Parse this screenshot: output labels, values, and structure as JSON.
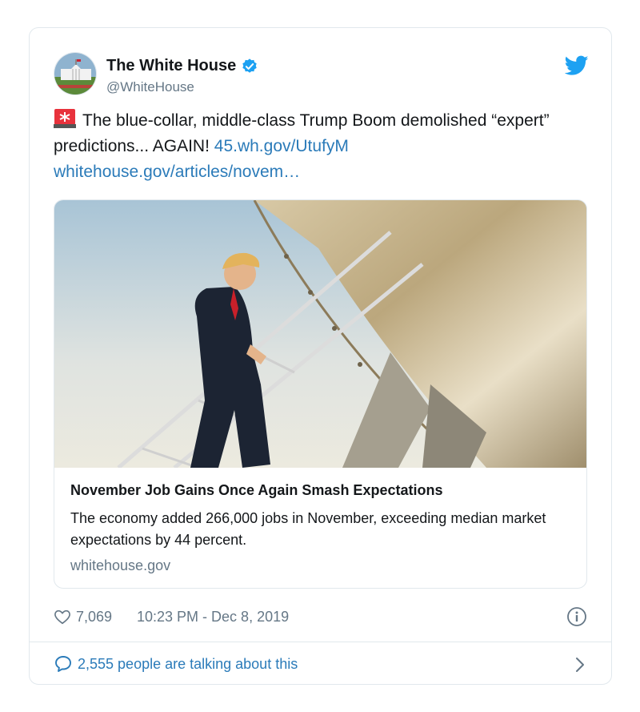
{
  "author": {
    "name": "The White House",
    "handle": "@WhiteHouse"
  },
  "tweet": {
    "text_prefix": "The blue-collar, middle-class Trump Boom demolished “expert” predictions... AGAIN! ",
    "link1": "45.wh.gov/UtufyM",
    "link2": "whitehouse.gov/articles/novem…"
  },
  "card": {
    "title": "November Job Gains Once Again Smash Expectations",
    "description": "The economy added 266,000 jobs in November, exceeding median market expectations by 44 percent.",
    "domain": "whitehouse.gov"
  },
  "meta": {
    "likes": "7,069",
    "timestamp": "10:23 PM - Dec 8, 2019"
  },
  "conversation": {
    "text": "2,555 people are talking about this"
  },
  "colors": {
    "link": "#2b7bb9",
    "secondary_text": "#657786",
    "verified": "#1da1f2",
    "border": "#e1e8ed"
  },
  "icons": [
    "verified-icon",
    "twitter-logo-icon",
    "siren-icon",
    "heart-icon",
    "info-icon",
    "chat-bubble-icon",
    "chevron-right-icon"
  ]
}
